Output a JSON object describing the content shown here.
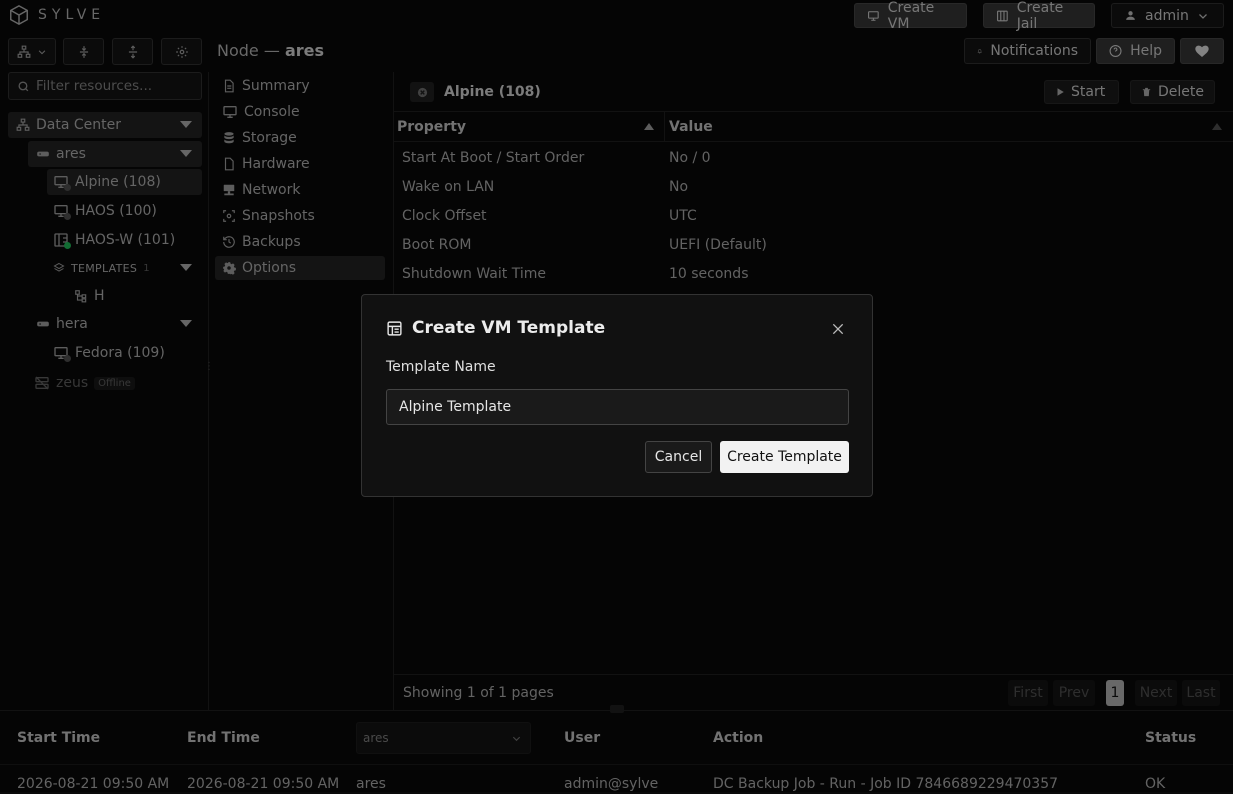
{
  "app": {
    "brand": "SYLVE"
  },
  "topbar": {
    "create_vm": "Create VM",
    "create_jail": "Create Jail",
    "user": "admin"
  },
  "header": {
    "node_prefix": "Node — ",
    "node_name": "ares",
    "notifications": "Notifications",
    "help": "Help"
  },
  "search": {
    "placeholder": "Filter resources..."
  },
  "tree": {
    "datacenter": "Data Center",
    "nodes": [
      {
        "name": "ares"
      },
      {
        "name": "hera"
      },
      {
        "name": "zeus",
        "badge": "Offline"
      }
    ],
    "vms": [
      "Alpine (108)",
      "HAOS (100)",
      "HAOS-W (101)",
      "Fedora (109)"
    ],
    "templates_label": "TEMPLATES",
    "templates_count": "1",
    "template_item": "H"
  },
  "menu": [
    "Summary",
    "Console",
    "Storage",
    "Hardware",
    "Network",
    "Snapshots",
    "Backups",
    "Options"
  ],
  "panel": {
    "title": "Alpine (108)",
    "start": "Start",
    "delete": "Delete",
    "columns": [
      "Property",
      "Value"
    ],
    "rows": [
      {
        "property": "Start At Boot / Start Order",
        "value": "No / 0"
      },
      {
        "property": "Wake on LAN",
        "value": "No"
      },
      {
        "property": "Clock Offset",
        "value": "UTC"
      },
      {
        "property": "Boot ROM",
        "value": "UEFI (Default)"
      },
      {
        "property": "Shutdown Wait Time",
        "value": "10 seconds"
      }
    ],
    "footer": "Showing 1 of 1 pages",
    "pager": {
      "first": "First",
      "prev": "Prev",
      "page": "1",
      "next": "Next",
      "last": "Last"
    }
  },
  "tasks": {
    "columns": {
      "start": "Start Time",
      "end": "End Time",
      "node_filter": "ares",
      "user": "User",
      "action": "Action",
      "status": "Status"
    },
    "row": {
      "start": "2026-08-21 09:50 AM",
      "end": "2026-08-21 09:50 AM",
      "node": "ares",
      "user": "admin@sylve",
      "action": "DC Backup Job - Run - Job ID 7846689229470357",
      "status": "OK"
    }
  },
  "modal": {
    "title": "Create VM Template",
    "label": "Template Name",
    "value": "Alpine Template",
    "cancel": "Cancel",
    "submit": "Create Template"
  },
  "colors": {
    "background": "#0a0a0a",
    "panel": "#111111",
    "primary_button": "#f2f2f2",
    "online": "#22c55e",
    "offline": "#555555"
  }
}
